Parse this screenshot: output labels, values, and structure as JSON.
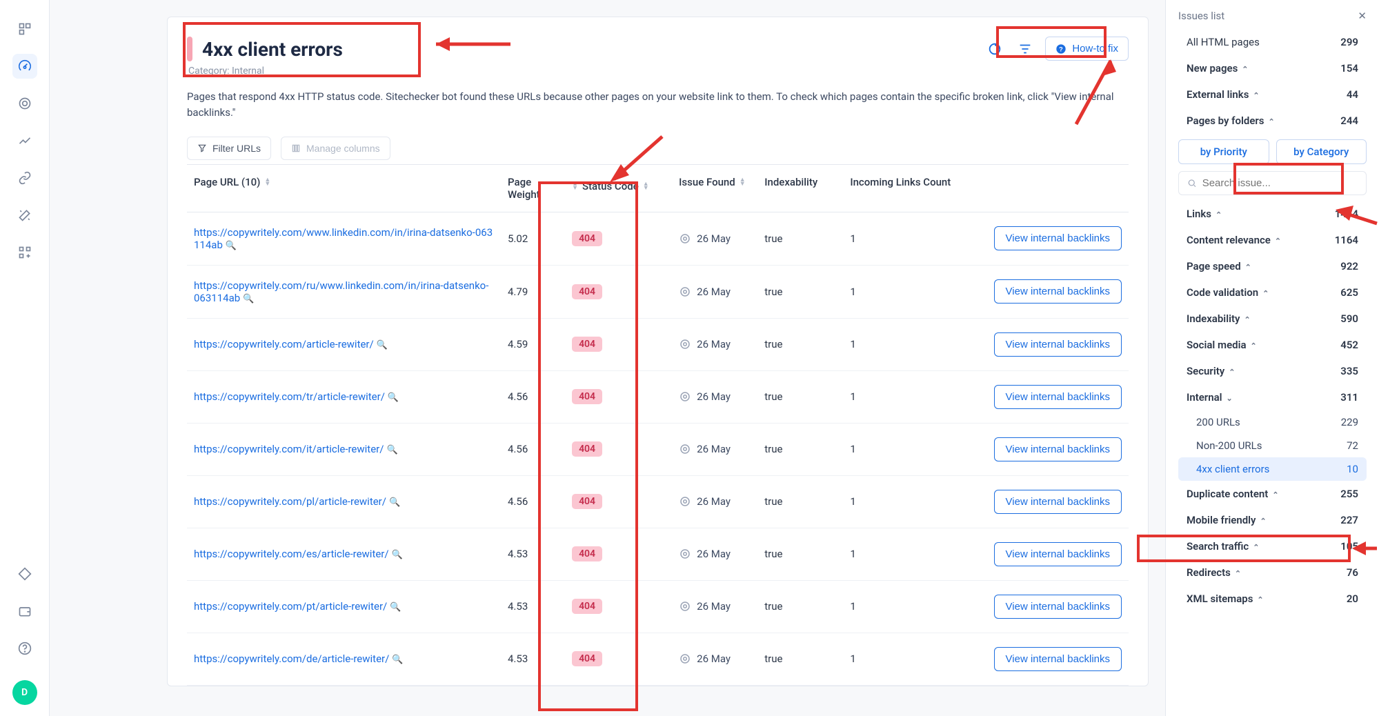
{
  "header": {
    "title": "4xx client errors",
    "category_prefix": "Category:",
    "category_value": "Internal",
    "description": "Pages that respond 4xx HTTP status code. Sitechecker bot found these URLs because other pages on your website link to them. To check which pages contain the specific broken link, click \"View internal backlinks.\"",
    "howto_label": "How-to fix"
  },
  "toolbar": {
    "filter_label": "Filter URLs",
    "columns_label": "Manage columns"
  },
  "table": {
    "headers": {
      "url": "Page URL (10)",
      "weight": "Page Weight",
      "status": "Status Code",
      "found": "Issue Found",
      "index": "Indexability",
      "incoming": "Incoming Links Count"
    },
    "view_label": "View internal backlinks",
    "rows": [
      {
        "url": "https://copywritely.com/www.linkedin.com/in/irina-datsenko-063114ab",
        "weight": "5.02",
        "status": "404",
        "found": "26 May",
        "index": "true",
        "incoming": "1"
      },
      {
        "url": "https://copywritely.com/ru/www.linkedin.com/in/irina-datsenko-063114ab",
        "weight": "4.79",
        "status": "404",
        "found": "26 May",
        "index": "true",
        "incoming": "1"
      },
      {
        "url": "https://copywritely.com/article-rewiter/",
        "weight": "4.59",
        "status": "404",
        "found": "26 May",
        "index": "true",
        "incoming": "1"
      },
      {
        "url": "https://copywritely.com/tr/article-rewiter/",
        "weight": "4.56",
        "status": "404",
        "found": "26 May",
        "index": "true",
        "incoming": "1"
      },
      {
        "url": "https://copywritely.com/it/article-rewiter/",
        "weight": "4.56",
        "status": "404",
        "found": "26 May",
        "index": "true",
        "incoming": "1"
      },
      {
        "url": "https://copywritely.com/pl/article-rewiter/",
        "weight": "4.56",
        "status": "404",
        "found": "26 May",
        "index": "true",
        "incoming": "1"
      },
      {
        "url": "https://copywritely.com/es/article-rewiter/",
        "weight": "4.53",
        "status": "404",
        "found": "26 May",
        "index": "true",
        "incoming": "1"
      },
      {
        "url": "https://copywritely.com/pt/article-rewiter/",
        "weight": "4.53",
        "status": "404",
        "found": "26 May",
        "index": "true",
        "incoming": "1"
      },
      {
        "url": "https://copywritely.com/de/article-rewiter/",
        "weight": "4.53",
        "status": "404",
        "found": "26 May",
        "index": "true",
        "incoming": "1"
      }
    ]
  },
  "rightpanel": {
    "title": "Issues list",
    "all_html": {
      "label": "All HTML pages",
      "count": "299"
    },
    "sections_top": [
      {
        "label": "New pages",
        "count": "154",
        "caret": "up"
      },
      {
        "label": "External links",
        "count": "44",
        "caret": "up"
      },
      {
        "label": "Pages by folders",
        "count": "244",
        "caret": "up"
      }
    ],
    "toggle": {
      "priority": "by Priority",
      "category": "by Category"
    },
    "search_placeholder": "Search issue...",
    "categories": [
      {
        "label": "Links",
        "count": "1414",
        "caret": "up"
      },
      {
        "label": "Content relevance",
        "count": "1164",
        "caret": "up"
      },
      {
        "label": "Page speed",
        "count": "922",
        "caret": "up"
      },
      {
        "label": "Code validation",
        "count": "625",
        "caret": "up"
      },
      {
        "label": "Indexability",
        "count": "590",
        "caret": "up"
      },
      {
        "label": "Social media",
        "count": "452",
        "caret": "up"
      },
      {
        "label": "Security",
        "count": "335",
        "caret": "up"
      }
    ],
    "internal": {
      "label": "Internal",
      "count": "311",
      "caret": "down",
      "children": [
        {
          "label": "200 URLs",
          "count": "229"
        },
        {
          "label": "Non-200 URLs",
          "count": "72"
        },
        {
          "label": "4xx client errors",
          "count": "10",
          "selected": true
        }
      ]
    },
    "categories_after": [
      {
        "label": "Duplicate content",
        "count": "255",
        "caret": "up"
      },
      {
        "label": "Mobile friendly",
        "count": "227",
        "caret": "up"
      },
      {
        "label": "Search traffic",
        "count": "105",
        "caret": "up"
      },
      {
        "label": "Redirects",
        "count": "76",
        "caret": "up"
      },
      {
        "label": "XML sitemaps",
        "count": "20",
        "caret": "up"
      }
    ]
  },
  "avatar_letter": "D"
}
